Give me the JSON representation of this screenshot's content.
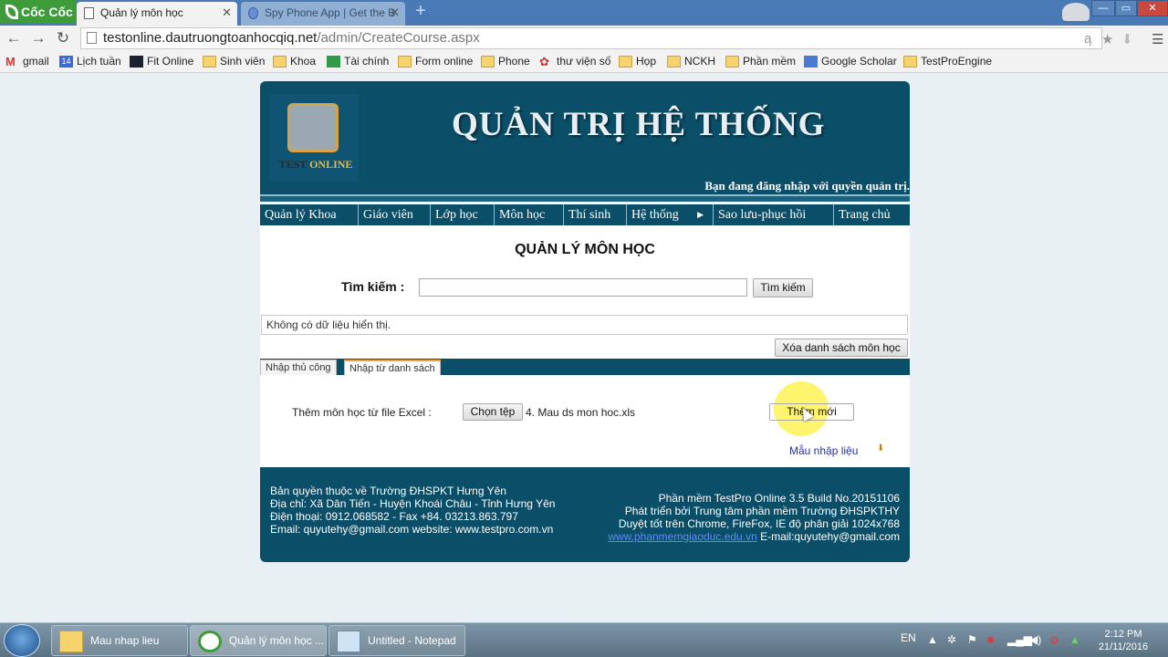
{
  "browser": {
    "brand": "Cốc Cốc",
    "tabs": [
      {
        "label": "Quản lý môn học",
        "active": true
      },
      {
        "label": "Spy Phone App | Get the B",
        "active": false
      }
    ],
    "url_host": "testonline.dautruongtoanhocqiq.net",
    "url_path": "/admin/CreateCourse.aspx",
    "bookmarks": [
      {
        "label": "gmail",
        "icon": "gmail-icon"
      },
      {
        "label": "Lịch tuần",
        "icon": "calendar-icon"
      },
      {
        "label": "Fit Online",
        "icon": "fit-icon"
      },
      {
        "label": "Sinh viên",
        "icon": "folder-icon"
      },
      {
        "label": "Khoa",
        "icon": "folder-icon"
      },
      {
        "label": "Tài chính",
        "icon": "sheet-icon"
      },
      {
        "label": "Form online",
        "icon": "folder-icon"
      },
      {
        "label": "Phone",
        "icon": "folder-icon"
      },
      {
        "label": "thư viện số",
        "icon": "library-icon"
      },
      {
        "label": "Họp",
        "icon": "folder-icon"
      },
      {
        "label": "NCKH",
        "icon": "folder-icon"
      },
      {
        "label": "Phần mềm",
        "icon": "folder-icon"
      },
      {
        "label": "Google Scholar",
        "icon": "scholar-icon"
      },
      {
        "label": "TestProEngine",
        "icon": "folder-icon"
      }
    ]
  },
  "header": {
    "logo_text_1": "TEST",
    "logo_text_2": "ONLINE",
    "title": "QUẢN TRỊ HỆ THỐNG",
    "login_text": "Bạn đang đăng nhập với quyền quản trị."
  },
  "menu": [
    {
      "label": "Quản lý Khoa"
    },
    {
      "label": "Giáo viên"
    },
    {
      "label": "Lớp học"
    },
    {
      "label": "Môn học"
    },
    {
      "label": "Thí sinh"
    },
    {
      "label": "Hệ thống"
    },
    {
      "label": "Sao lưu-phục hồi"
    },
    {
      "label": "Trang chủ"
    }
  ],
  "main": {
    "title": "QUẢN LÝ MÔN HỌC",
    "search_label": "Tìm kiếm :",
    "search_value": "",
    "search_button": "Tìm kiếm",
    "no_data": "Không có dữ liệu hiển thị.",
    "clear_button": "Xóa danh sách môn học",
    "tabs": [
      {
        "label": "Nhập thủ công",
        "selected": false
      },
      {
        "label": "Nhập từ danh sách",
        "selected": true
      }
    ],
    "excel_label": "Thêm môn học từ file Excel :",
    "choose_file_button": "Chọn tệp",
    "file_name": "4. Mau ds mon hoc.xls",
    "add_button": "Thêm mới",
    "template_link": "Mẫu nhập liệu"
  },
  "footer": {
    "left": [
      "Bản quyền thuộc về Trường ĐHSPKT Hưng Yên",
      "Địa chỉ: Xã Dân Tiến - Huyện Khoái Châu - Tỉnh Hưng Yên",
      "Điện thoại: 0912.068582 - Fax +84. 03213.863.797",
      "Email: quyutehy@gmail.com website: www.testpro.com.vn"
    ],
    "right": [
      "Phần mềm TestPro Online 3.5 Build No.20151106",
      "Phát triển bởi Trung tâm phần mềm Trường ĐHSPKTHY",
      "Duyệt tốt trên Chrome, FireFox, IE độ phân giải 1024x768"
    ],
    "link": "www.phanmemgiaoduc.edu.vn",
    "email": "E-mail:quyutehy@gmail.com"
  },
  "taskbar": {
    "items": [
      {
        "label": "Mau nhap lieu",
        "active": false
      },
      {
        "label": "Quản lý môn học ...",
        "active": true
      },
      {
        "label": "Untitled - Notepad",
        "active": false
      }
    ],
    "language": "EN",
    "time": "2:12 PM",
    "date": "21/11/2016"
  },
  "colors": {
    "header_bg": "#0b4e68",
    "accent": "#f0a030",
    "link": "#2431a8",
    "highlight": "#ffef3c"
  }
}
